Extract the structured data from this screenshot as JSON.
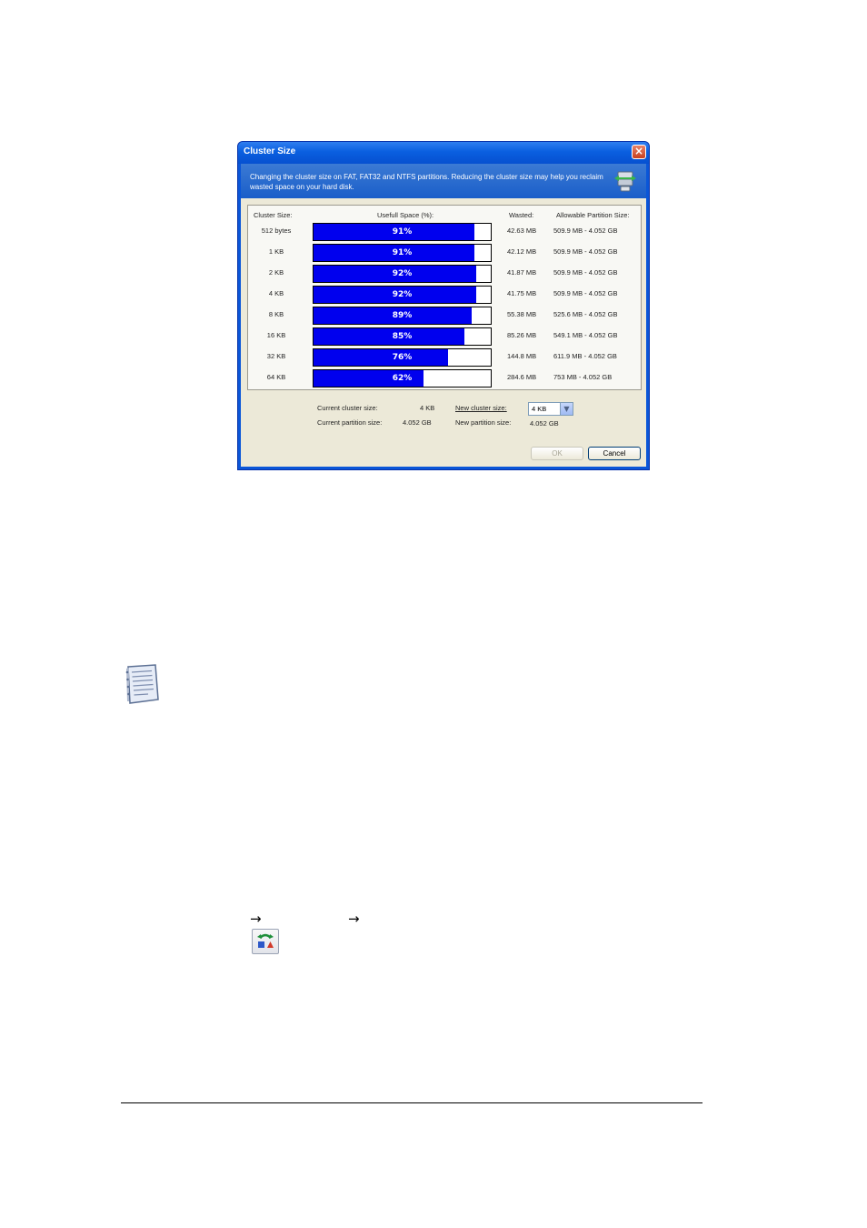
{
  "dialog": {
    "title": "Cluster Size",
    "close_label": "×",
    "description": "Changing the cluster size on FAT, FAT32 and NTFS partitions. Reducing the cluster size may help you reclaim wasted space on your hard disk.",
    "icon": "partition-cluster-icon"
  },
  "table": {
    "headers": {
      "cluster_size": "Cluster Size:",
      "useful_space": "Usefull Space (%):",
      "wasted": "Wasted:",
      "allowable": "Allowable Partition Size:"
    },
    "rows": [
      {
        "size": "512 bytes",
        "useful": 91,
        "pct_label": "91%",
        "wasted": "42.63 MB",
        "allowable": "509.9 MB - 4.052 GB"
      },
      {
        "size": "1 KB",
        "useful": 91,
        "pct_label": "91%",
        "wasted": "42.12 MB",
        "allowable": "509.9 MB - 4.052 GB"
      },
      {
        "size": "2 KB",
        "useful": 92,
        "pct_label": "92%",
        "wasted": "41.87 MB",
        "allowable": "509.9 MB - 4.052 GB"
      },
      {
        "size": "4 KB",
        "useful": 92,
        "pct_label": "92%",
        "wasted": "41.75 MB",
        "allowable": "509.9 MB - 4.052 GB"
      },
      {
        "size": "8 KB",
        "useful": 89,
        "pct_label": "89%",
        "wasted": "55.38 MB",
        "allowable": "525.6 MB - 4.052 GB"
      },
      {
        "size": "16 KB",
        "useful": 85,
        "pct_label": "85%",
        "wasted": "85.26 MB",
        "allowable": "549.1 MB - 4.052 GB"
      },
      {
        "size": "32 KB",
        "useful": 76,
        "pct_label": "76%",
        "wasted": "144.8 MB",
        "allowable": "611.9 MB - 4.052 GB"
      },
      {
        "size": "64 KB",
        "useful": 62,
        "pct_label": "62%",
        "wasted": "284.6 MB",
        "allowable": "753 MB - 4.052 GB"
      }
    ],
    "bar_color": "#0000ee"
  },
  "info": {
    "current_cluster_label": "Current cluster size:",
    "current_cluster_value": "4 KB",
    "current_partition_label": "Current partition size:",
    "current_partition_value": "4.052 GB",
    "new_cluster_label": "New cluster size:",
    "new_cluster_value": "4 KB",
    "new_partition_label": "New partition size:",
    "new_partition_value": "4.052 GB"
  },
  "buttons": {
    "ok": "OK",
    "cancel": "Cancel"
  },
  "page": {
    "arrow_glyph": "→",
    "note_icon": "note-icon",
    "toolbar_icon": "cluster-size-toolbar-icon"
  }
}
